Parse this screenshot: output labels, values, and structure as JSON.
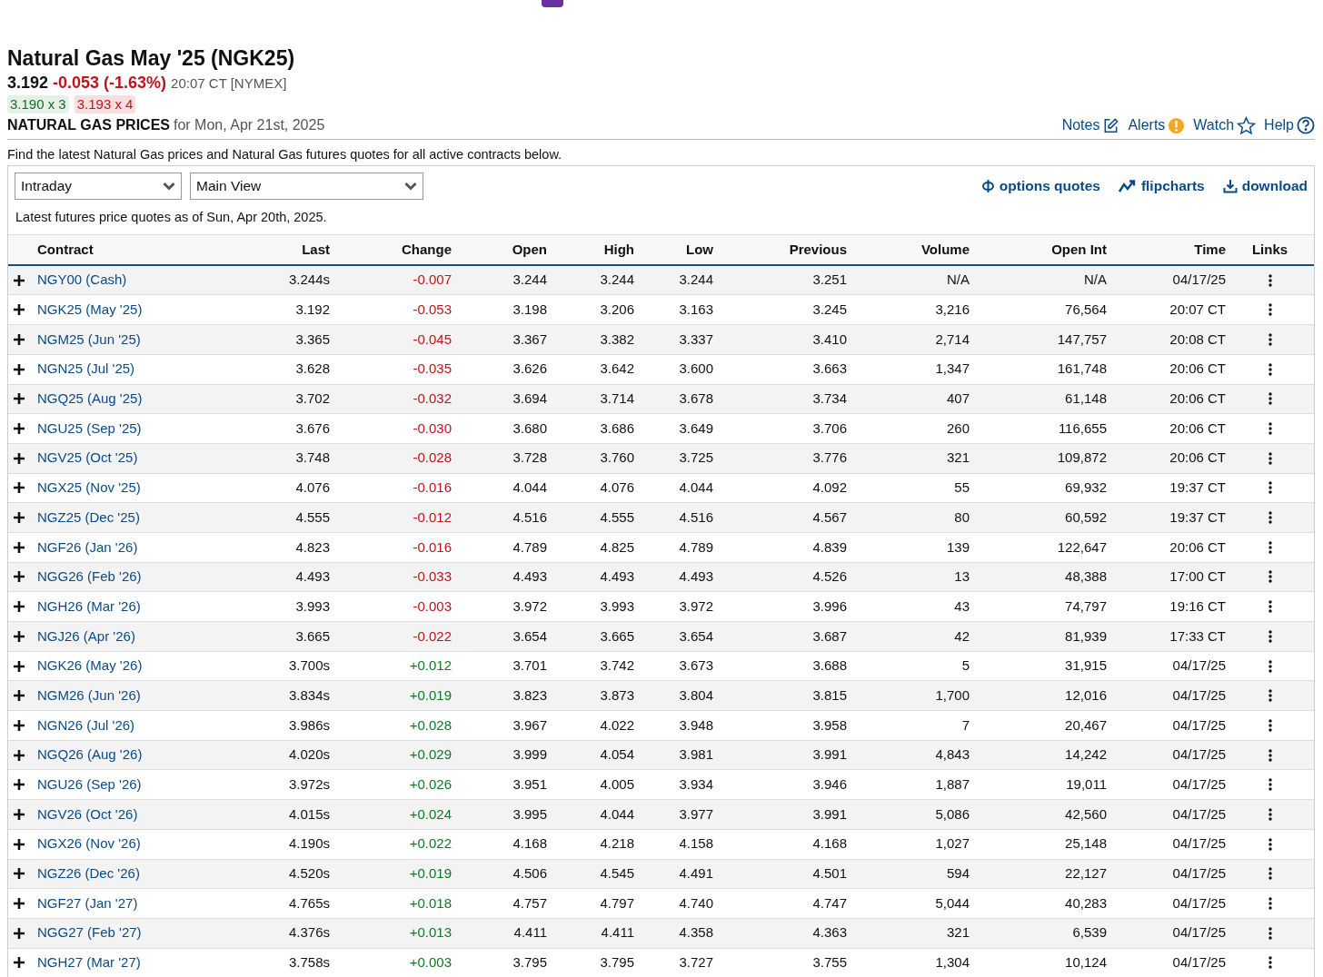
{
  "title": "Natural Gas May '25 (NGK25)",
  "quote": {
    "last": "3.192",
    "change": "-0.053 (-1.63%)",
    "kind": "down",
    "time": "20:07 CT [NYMEX]",
    "bid": "3.190 x 3",
    "ask": "3.193 x 4"
  },
  "prices_heading": {
    "label": "NATURAL GAS PRICES",
    "date": "for Mon, Apr 21st, 2025"
  },
  "actions": [
    "Notes",
    "Alerts",
    "Watch",
    "Help"
  ],
  "intro": "Find the latest Natural Gas prices and Natural Gas futures quotes for all active contracts below.",
  "dropdowns": [
    {
      "value": "Intraday"
    },
    {
      "value": "Main View"
    }
  ],
  "tools": [
    "options quotes",
    "flipcharts",
    "download"
  ],
  "as_of": "Latest futures price quotes as of Sun, Apr 20th, 2025.",
  "table": {
    "columns": [
      "Contract",
      "Last",
      "Change",
      "Open",
      "High",
      "Low",
      "Previous",
      "Volume",
      "Open Int",
      "Time",
      "Links"
    ],
    "rows": [
      {
        "contract": "NGY00 (Cash)",
        "last": "3.244s",
        "change": "-0.007",
        "kind": "down",
        "open": "3.244",
        "high": "3.244",
        "low": "3.244",
        "previous": "3.251",
        "volume": "N/A",
        "open_int": "N/A",
        "time": "04/17/25"
      },
      {
        "contract": "NGK25 (May '25)",
        "last": "3.192",
        "change": "-0.053",
        "kind": "down",
        "open": "3.198",
        "high": "3.206",
        "low": "3.163",
        "previous": "3.245",
        "volume": "3,216",
        "open_int": "76,564",
        "time": "20:07 CT"
      },
      {
        "contract": "NGM25 (Jun '25)",
        "last": "3.365",
        "change": "-0.045",
        "kind": "down",
        "open": "3.367",
        "high": "3.382",
        "low": "3.337",
        "previous": "3.410",
        "volume": "2,714",
        "open_int": "147,757",
        "time": "20:08 CT"
      },
      {
        "contract": "NGN25 (Jul '25)",
        "last": "3.628",
        "change": "-0.035",
        "kind": "down",
        "open": "3.626",
        "high": "3.642",
        "low": "3.600",
        "previous": "3.663",
        "volume": "1,347",
        "open_int": "161,748",
        "time": "20:06 CT"
      },
      {
        "contract": "NGQ25 (Aug '25)",
        "last": "3.702",
        "change": "-0.032",
        "kind": "down",
        "open": "3.694",
        "high": "3.714",
        "low": "3.678",
        "previous": "3.734",
        "volume": "407",
        "open_int": "61,148",
        "time": "20:06 CT"
      },
      {
        "contract": "NGU25 (Sep '25)",
        "last": "3.676",
        "change": "-0.030",
        "kind": "down",
        "open": "3.680",
        "high": "3.686",
        "low": "3.649",
        "previous": "3.706",
        "volume": "260",
        "open_int": "116,655",
        "time": "20:06 CT"
      },
      {
        "contract": "NGV25 (Oct '25)",
        "last": "3.748",
        "change": "-0.028",
        "kind": "down",
        "open": "3.728",
        "high": "3.760",
        "low": "3.725",
        "previous": "3.776",
        "volume": "321",
        "open_int": "109,872",
        "time": "20:06 CT"
      },
      {
        "contract": "NGX25 (Nov '25)",
        "last": "4.076",
        "change": "-0.016",
        "kind": "down",
        "open": "4.044",
        "high": "4.076",
        "low": "4.044",
        "previous": "4.092",
        "volume": "55",
        "open_int": "69,932",
        "time": "19:37 CT"
      },
      {
        "contract": "NGZ25 (Dec '25)",
        "last": "4.555",
        "change": "-0.012",
        "kind": "down",
        "open": "4.516",
        "high": "4.555",
        "low": "4.516",
        "previous": "4.567",
        "volume": "80",
        "open_int": "60,592",
        "time": "19:37 CT"
      },
      {
        "contract": "NGF26 (Jan '26)",
        "last": "4.823",
        "change": "-0.016",
        "kind": "down",
        "open": "4.789",
        "high": "4.825",
        "low": "4.789",
        "previous": "4.839",
        "volume": "139",
        "open_int": "122,647",
        "time": "20:06 CT"
      },
      {
        "contract": "NGG26 (Feb '26)",
        "last": "4.493",
        "change": "-0.033",
        "kind": "down",
        "open": "4.493",
        "high": "4.493",
        "low": "4.493",
        "previous": "4.526",
        "volume": "13",
        "open_int": "48,388",
        "time": "17:00 CT"
      },
      {
        "contract": "NGH26 (Mar '26)",
        "last": "3.993",
        "change": "-0.003",
        "kind": "down",
        "open": "3.972",
        "high": "3.993",
        "low": "3.972",
        "previous": "3.996",
        "volume": "43",
        "open_int": "74,797",
        "time": "19:16 CT"
      },
      {
        "contract": "NGJ26 (Apr '26)",
        "last": "3.665",
        "change": "-0.022",
        "kind": "down",
        "open": "3.654",
        "high": "3.665",
        "low": "3.654",
        "previous": "3.687",
        "volume": "42",
        "open_int": "81,939",
        "time": "17:33 CT"
      },
      {
        "contract": "NGK26 (May '26)",
        "last": "3.700s",
        "change": "+0.012",
        "kind": "up",
        "open": "3.701",
        "high": "3.742",
        "low": "3.673",
        "previous": "3.688",
        "volume": "5",
        "open_int": "31,915",
        "time": "04/17/25"
      },
      {
        "contract": "NGM26 (Jun '26)",
        "last": "3.834s",
        "change": "+0.019",
        "kind": "up",
        "open": "3.823",
        "high": "3.873",
        "low": "3.804",
        "previous": "3.815",
        "volume": "1,700",
        "open_int": "12,016",
        "time": "04/17/25"
      },
      {
        "contract": "NGN26 (Jul '26)",
        "last": "3.986s",
        "change": "+0.028",
        "kind": "up",
        "open": "3.967",
        "high": "4.022",
        "low": "3.948",
        "previous": "3.958",
        "volume": "7",
        "open_int": "20,467",
        "time": "04/17/25"
      },
      {
        "contract": "NGQ26 (Aug '26)",
        "last": "4.020s",
        "change": "+0.029",
        "kind": "up",
        "open": "3.999",
        "high": "4.054",
        "low": "3.981",
        "previous": "3.991",
        "volume": "4,843",
        "open_int": "14,242",
        "time": "04/17/25"
      },
      {
        "contract": "NGU26 (Sep '26)",
        "last": "3.972s",
        "change": "+0.026",
        "kind": "up",
        "open": "3.951",
        "high": "4.005",
        "low": "3.934",
        "previous": "3.946",
        "volume": "1,887",
        "open_int": "19,011",
        "time": "04/17/25"
      },
      {
        "contract": "NGV26 (Oct '26)",
        "last": "4.015s",
        "change": "+0.024",
        "kind": "up",
        "open": "3.995",
        "high": "4.044",
        "low": "3.977",
        "previous": "3.991",
        "volume": "5,086",
        "open_int": "42,560",
        "time": "04/17/25"
      },
      {
        "contract": "NGX26 (Nov '26)",
        "last": "4.190s",
        "change": "+0.022",
        "kind": "up",
        "open": "4.168",
        "high": "4.218",
        "low": "4.158",
        "previous": "4.168",
        "volume": "1,027",
        "open_int": "25,148",
        "time": "04/17/25"
      },
      {
        "contract": "NGZ26 (Dec '26)",
        "last": "4.520s",
        "change": "+0.019",
        "kind": "up",
        "open": "4.506",
        "high": "4.545",
        "low": "4.491",
        "previous": "4.501",
        "volume": "594",
        "open_int": "22,127",
        "time": "04/17/25"
      },
      {
        "contract": "NGF27 (Jan '27)",
        "last": "4.765s",
        "change": "+0.018",
        "kind": "up",
        "open": "4.757",
        "high": "4.797",
        "low": "4.740",
        "previous": "4.747",
        "volume": "5,044",
        "open_int": "40,283",
        "time": "04/17/25"
      },
      {
        "contract": "NGG27 (Feb '27)",
        "last": "4.376s",
        "change": "+0.013",
        "kind": "up",
        "open": "4.411",
        "high": "4.411",
        "low": "4.358",
        "previous": "4.363",
        "volume": "321",
        "open_int": "6,539",
        "time": "04/17/25"
      },
      {
        "contract": "NGH27 (Mar '27)",
        "last": "3.758s",
        "change": "+0.003",
        "kind": "up",
        "open": "3.795",
        "high": "3.795",
        "low": "3.727",
        "previous": "3.755",
        "volume": "1,304",
        "open_int": "10,124",
        "time": "04/17/25"
      }
    ]
  }
}
